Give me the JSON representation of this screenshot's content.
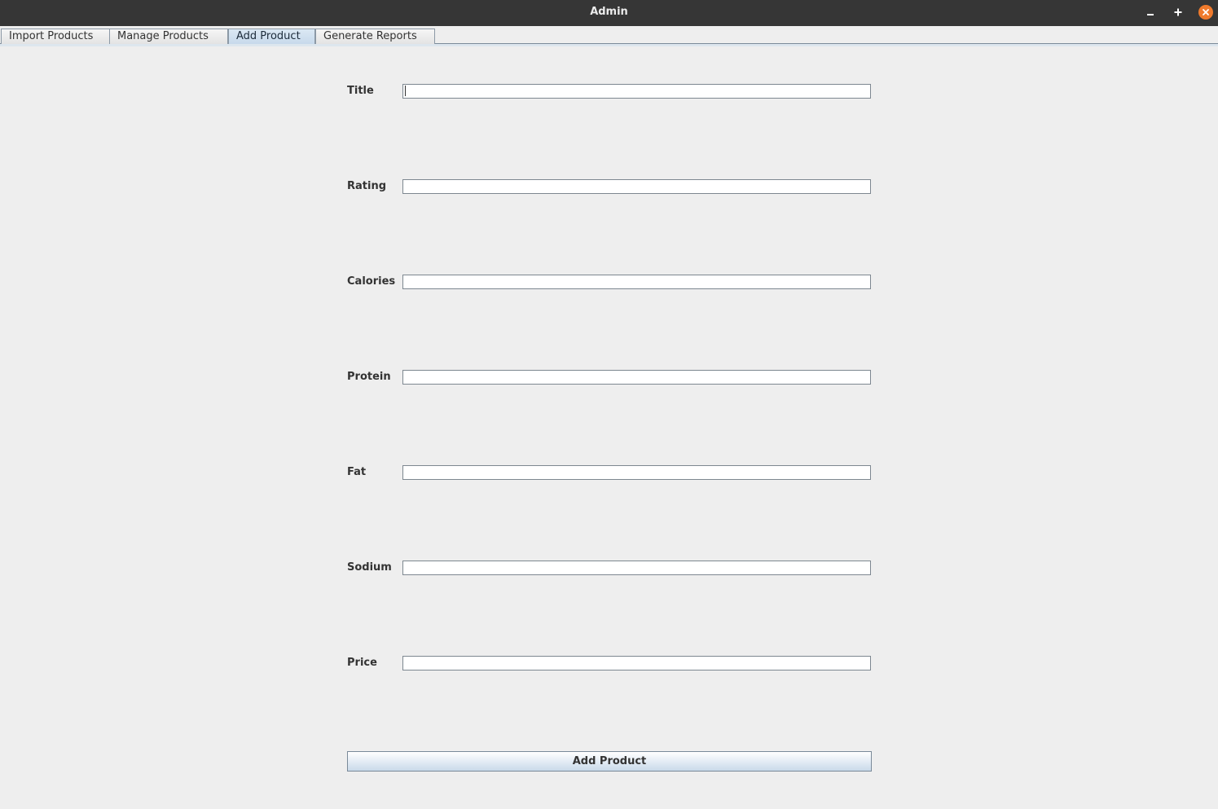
{
  "window": {
    "title": "Admin",
    "controls": {
      "minimize_icon": "minimize-icon",
      "maximize_icon": "maximize-icon",
      "close_icon": "close-icon",
      "close_color": "#ef7a2c"
    }
  },
  "tabs": [
    {
      "label": "Import Products",
      "selected": false
    },
    {
      "label": "Manage Products",
      "selected": false
    },
    {
      "label": "Add Product",
      "selected": true
    },
    {
      "label": "Generate Reports",
      "selected": false
    }
  ],
  "form": {
    "fields": [
      {
        "label": "Title",
        "value": "",
        "focused": true
      },
      {
        "label": "Rating",
        "value": ""
      },
      {
        "label": "Calories",
        "value": ""
      },
      {
        "label": "Protein",
        "value": ""
      },
      {
        "label": "Fat",
        "value": ""
      },
      {
        "label": "Sodium",
        "value": ""
      },
      {
        "label": "Price",
        "value": ""
      }
    ],
    "submit_label": "Add Product"
  },
  "colors": {
    "titlebar": "#363636",
    "background": "#eeeeee",
    "selected_tab": "#c7d9eb"
  }
}
